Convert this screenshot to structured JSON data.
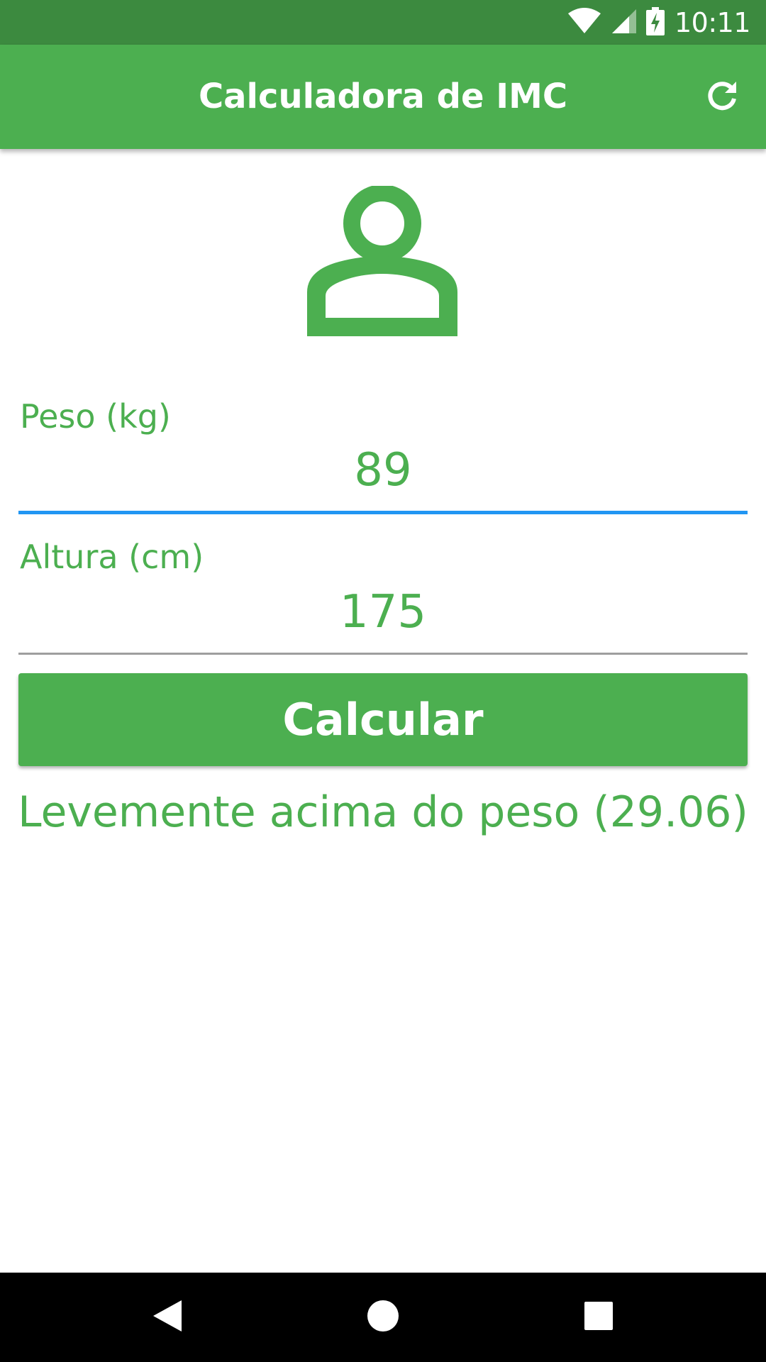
{
  "status_bar": {
    "time": "10:11",
    "icons": [
      "wifi-icon",
      "signal-icon",
      "battery-charging-icon"
    ]
  },
  "app_bar": {
    "title": "Calculadora de IMC",
    "refresh_icon": "refresh-icon"
  },
  "header_icon": "person-outline-icon",
  "form": {
    "weight": {
      "label": "Peso (kg)",
      "value": "89"
    },
    "height": {
      "label": "Altura (cm)",
      "value": "175"
    },
    "calculate_label": "Calcular"
  },
  "result": {
    "text": "Levemente acima do peso (29.06)"
  },
  "nav_bar": {
    "icons": [
      "back-icon",
      "home-icon",
      "recents-icon"
    ]
  },
  "colors": {
    "primary": "#4caf50",
    "primary_dark": "#3c8a3f",
    "focus_underline": "#2196f3",
    "underline": "#9e9e9e"
  }
}
